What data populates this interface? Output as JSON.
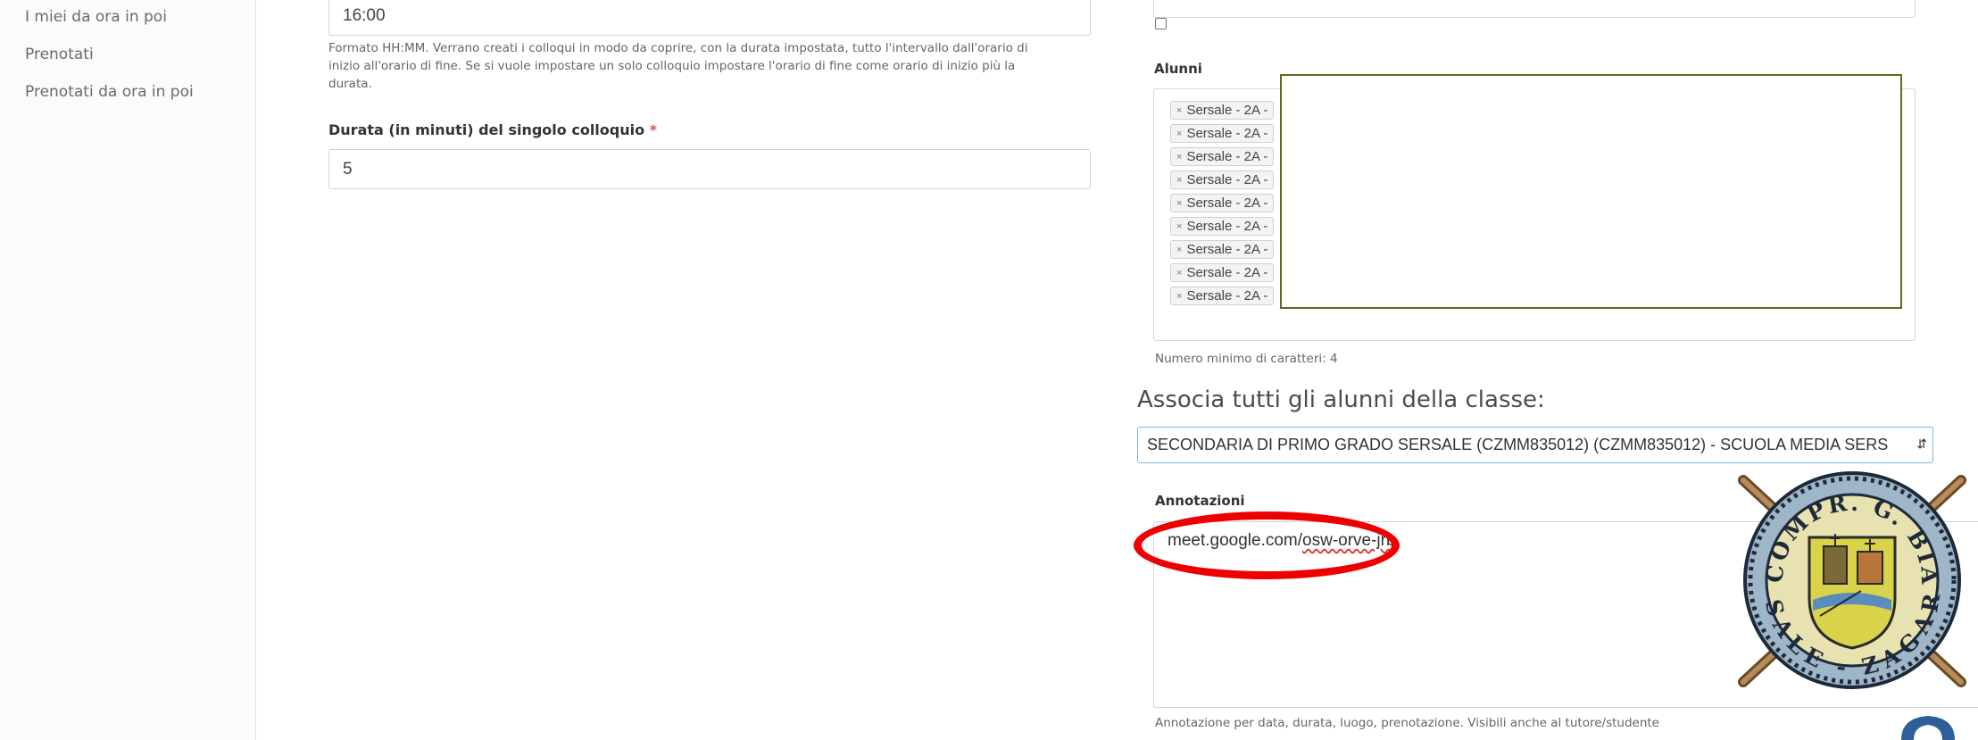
{
  "sidebar": {
    "items": [
      {
        "label": "I miei da ora in poi"
      },
      {
        "label": "Prenotati"
      },
      {
        "label": "Prenotati da ora in poi"
      }
    ]
  },
  "form": {
    "end_time_value": "16:00",
    "end_time_help": [
      "Formato HH:MM. Verrano creati i colloqui in modo da coprire, con la durata impostata, tutto l'intervallo dall'orario di",
      "inizio all'orario di fine. Se si vuole impostare un solo colloquio impostare l'orario di fine come orario di inizio più la",
      "durata."
    ],
    "duration_label": "Durata (in minuti) del singolo colloquio",
    "required_mark": "*",
    "duration_value": "5"
  },
  "students": {
    "label": "Alunni",
    "tags": [
      "Sersale - 2A -",
      "Sersale - 2A -",
      "Sersale - 2A -",
      "Sersale - 2A -",
      "Sersale - 2A -",
      "Sersale - 2A -",
      "Sersale - 2A -",
      "Sersale - 2A -",
      "Sersale - 2A -"
    ],
    "remove_glyph": "×",
    "help": "Numero minimo di caratteri: 4"
  },
  "associate": {
    "title": "Associa tutti gli alunni della classe:",
    "selected": "SECONDARIA DI PRIMO GRADO SERSALE (CZMM835012) (CZMM835012) - SCUOLA MEDIA SERS"
  },
  "annotations": {
    "label": "Annotazioni",
    "text_prefix": "meet.google.com/",
    "text_link": "osw-orve-jrb",
    "help": "Annotazione per data, durata, luogo, prenotazione. Visibili anche al tutore/studente"
  },
  "logo": {
    "top_text": "IST. COMPR. G. BIANCO",
    "bottom_text": "SERSALE - ZAGARISE"
  },
  "colors": {
    "highlight_ellipse": "#ee0000",
    "redaction_border": "#5d6b1e",
    "focus_border": "#7fb3e0"
  }
}
